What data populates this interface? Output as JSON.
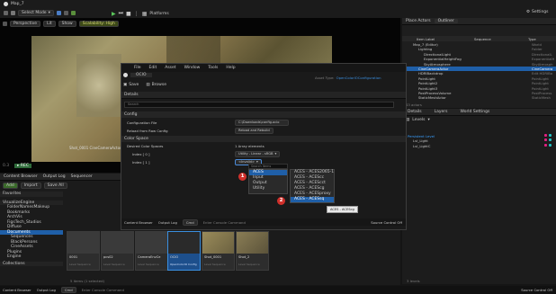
{
  "app": {
    "title": "Map_7",
    "mode_label": "Select Mode",
    "platforms_label": "Platforms",
    "settings_label": "Settings"
  },
  "viewport": {
    "perspective_label": "Perspective",
    "lit_label": "Lit",
    "show_label": "Show",
    "scalability_label": "Scalability: High",
    "overlay_text": "Shot_0001 CineCameraActor",
    "fps_label": "0.3"
  },
  "outliner": {
    "tab_label": "Place Actors",
    "tab2_label": "Outliner",
    "col_label": "Item Label",
    "col_type": "Type",
    "col_sequence": "Sequence",
    "rows": [
      {
        "label": "Map_7 (Editor)",
        "type": "World"
      },
      {
        "label": "Lighting",
        "type": "Folder"
      },
      {
        "label": "DirectionalLight",
        "type": "DirectionalL"
      },
      {
        "label": "ExponentialHeightFog",
        "type": "ExponentialH"
      },
      {
        "label": "SkyAtmosphere",
        "type": "SkyAtmosph"
      },
      {
        "label": "CineCameraActor",
        "type": "CineCamera"
      },
      {
        "label": "HDRIBackdrop",
        "type": "Edit HDRIBa"
      },
      {
        "label": "PointLight",
        "type": "PointLight"
      },
      {
        "label": "PointLight2",
        "type": "PointLight"
      },
      {
        "label": "PointLight3",
        "type": "PointLight"
      },
      {
        "label": "PostProcessVolume",
        "type": "PostProcess"
      },
      {
        "label": "StaticMeshActor",
        "type": "StaticMesh"
      }
    ],
    "actor_count": "43 actors"
  },
  "details": {
    "tab_label": "Details",
    "layers_label": "Layers",
    "world_settings_label": "World Settings",
    "levels_label": "Levels",
    "level_rows": [
      "Persistent Level",
      "Lvl_Light",
      "Lvl_LightC"
    ],
    "level_count": "3 levels"
  },
  "ocio": {
    "window_title": "OCIO",
    "menu": [
      "File",
      "Edit",
      "Asset",
      "Window",
      "Tools",
      "Help"
    ],
    "save_label": "Save",
    "browse_label": "Browse",
    "details_tab": "Details",
    "asset_type_label": "Asset Type:",
    "asset_type_value": "OpenColorIOConfiguration",
    "search_placeholder": "Search",
    "section_config": "Config",
    "config_file_label": "Configuration File",
    "config_file_value": "C:\\Downloads\\config.ocio",
    "reload_label": "Reload from Raw Config",
    "reload_button": "Reload and Rebuild",
    "section_color_space": "Color Space",
    "desired_label": "Desired Color Spaces",
    "desired_value": "1 Array elements",
    "index0_label": "Index [ 0 ]",
    "index0_value": "Utility - Linear - sRGB",
    "index1_label": "Index [ 1 ]",
    "index1_value": "<Invalid>",
    "search_menu_placeholder": "Search Items",
    "menu_items": [
      "ACES",
      "Input",
      "Output",
      "Utility"
    ],
    "submenu_items": [
      "ACES - ACES2065-1",
      "ACES - ACEScc",
      "ACES - ACEScct",
      "ACES - ACEScg",
      "ACES - ACESproxy",
      "ACES - ACESsq"
    ],
    "tooltip": "ACES - ACEScg",
    "badge1": "1",
    "badge2": "2"
  },
  "content_browser": {
    "tab_label": "Content Browser",
    "output_log_label": "Output Log",
    "add_label": "Add",
    "import_label": "Import",
    "save_all_label": "Save All",
    "sequencer_label": "Sequencer",
    "favorites_label": "Favorites",
    "root_label": "VisualizeEngine",
    "folders": [
      "FolderNamesMakeup",
      "Bookmarks",
      "ArchVis",
      "FigsTech_Studios",
      "Diffuse",
      "Documents",
      "Sequences",
      "BlackPersons",
      "CineAssets",
      "Plugins",
      "Engine"
    ],
    "collections_label": "Collections",
    "items_count": "5 items (1 selected)",
    "cmd_label": "Cmd",
    "cmd_placeholder": "Enter Console Command",
    "source_control": "Source Control Off",
    "thumbs": [
      {
        "label": "0001",
        "sub": "Level Sequence"
      },
      {
        "label": "pcs02",
        "sub": "Level Sequence"
      },
      {
        "label": "CameraEnvCe",
        "sub": "Level Sequence"
      },
      {
        "label": "OCIO",
        "sub": "OpenColorIO Config"
      },
      {
        "label": "Shot_0001",
        "sub": "Level Sequence"
      },
      {
        "label": "Shot_2",
        "sub": "Level Sequence"
      }
    ]
  },
  "colors": {
    "accent": "#1f5fa8",
    "badge": "#d0302b",
    "viewport_green": "#2f6b3a"
  }
}
